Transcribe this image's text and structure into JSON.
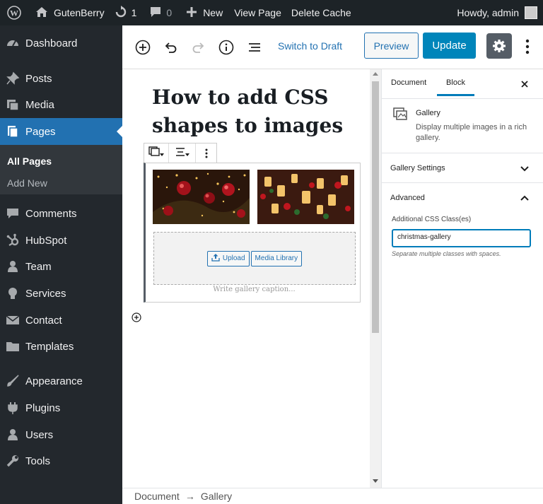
{
  "adminbar": {
    "site_name": "GutenBerry",
    "updates_count": "1",
    "comments_count": "0",
    "new_label": "New",
    "view_page": "View Page",
    "delete_cache": "Delete Cache",
    "howdy": "Howdy, admin"
  },
  "sidebar": {
    "items": [
      {
        "label": "Dashboard",
        "icon": "dashboard-icon"
      },
      {
        "label": "Posts",
        "icon": "pin-icon"
      },
      {
        "label": "Media",
        "icon": "media-icon"
      },
      {
        "label": "Pages",
        "icon": "pages-icon"
      },
      {
        "label": "Comments",
        "icon": "comments-icon"
      },
      {
        "label": "HubSpot",
        "icon": "hubspot-icon"
      },
      {
        "label": "Team",
        "icon": "team-icon"
      },
      {
        "label": "Services",
        "icon": "lightbulb-icon"
      },
      {
        "label": "Contact",
        "icon": "mail-icon"
      },
      {
        "label": "Templates",
        "icon": "folder-icon"
      },
      {
        "label": "Appearance",
        "icon": "brush-icon"
      },
      {
        "label": "Plugins",
        "icon": "plugin-icon"
      },
      {
        "label": "Users",
        "icon": "user-icon"
      },
      {
        "label": "Tools",
        "icon": "wrench-icon"
      }
    ],
    "submenu": [
      "All Pages",
      "Add New"
    ]
  },
  "toolbar": {
    "switch_draft": "Switch to Draft",
    "preview": "Preview",
    "update": "Update"
  },
  "editor": {
    "title": "How to add CSS shapes to images",
    "upload": "Upload",
    "media_library": "Media Library",
    "caption_placeholder": "Write gallery caption..."
  },
  "panel": {
    "tab_document": "Document",
    "tab_block": "Block",
    "block_name": "Gallery",
    "block_desc": "Display multiple images in a rich gallery.",
    "gallery_settings": "Gallery Settings",
    "advanced": "Advanced",
    "css_label": "Additional CSS Class(es)",
    "css_value": "christmas-gallery",
    "css_help": "Separate multiple classes with spaces."
  },
  "footer": {
    "crumb_document": "Document",
    "arrow": "→",
    "crumb_gallery": "Gallery"
  },
  "colors": {
    "accent": "#2271b1",
    "update": "#0085ba",
    "adminbar": "#1d2327",
    "sidebar": "#23282d"
  }
}
